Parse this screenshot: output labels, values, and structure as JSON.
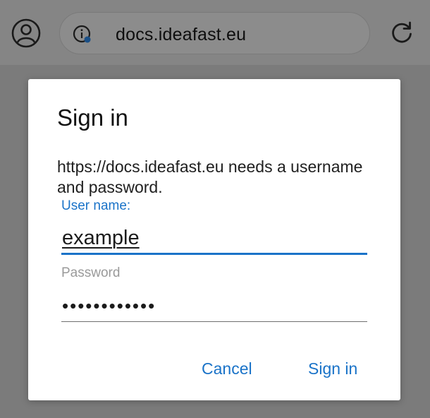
{
  "browser": {
    "url": "docs.ideafast.eu",
    "icons": {
      "profile": "profile-icon",
      "site_info": "info-icon",
      "reload": "reload-icon"
    }
  },
  "dialog": {
    "title": "Sign in",
    "message": "https://docs.ideafast.eu needs a username and password.",
    "username": {
      "label": "User name:",
      "value": "example"
    },
    "password": {
      "label": "Password",
      "value": "••••••••••••"
    },
    "buttons": {
      "cancel": "Cancel",
      "sign_in": "Sign in"
    }
  },
  "colors": {
    "accent": "#1a73c8",
    "scrim": "#7b7b7b"
  }
}
